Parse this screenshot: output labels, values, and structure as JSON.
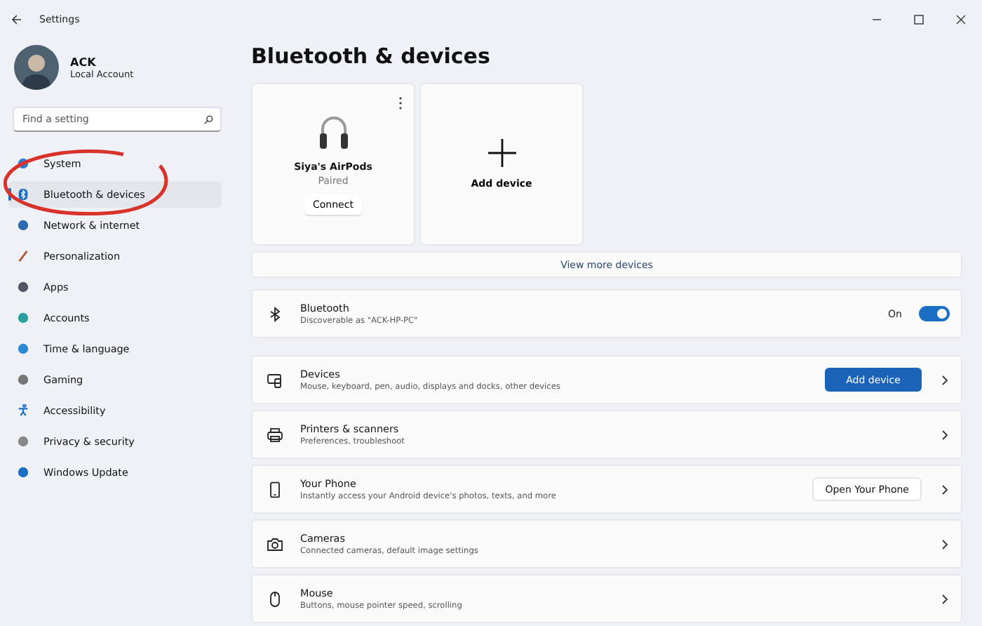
{
  "window": {
    "title": "Settings"
  },
  "account": {
    "name": "ACK",
    "type": "Local Account"
  },
  "search": {
    "placeholder": "Find a setting"
  },
  "sidebar": {
    "items": [
      {
        "label": "System",
        "selected": false
      },
      {
        "label": "Bluetooth & devices",
        "selected": true
      },
      {
        "label": "Network & internet",
        "selected": false
      },
      {
        "label": "Personalization",
        "selected": false
      },
      {
        "label": "Apps",
        "selected": false
      },
      {
        "label": "Accounts",
        "selected": false
      },
      {
        "label": "Time & language",
        "selected": false
      },
      {
        "label": "Gaming",
        "selected": false
      },
      {
        "label": "Accessibility",
        "selected": false
      },
      {
        "label": "Privacy & security",
        "selected": false
      },
      {
        "label": "Windows Update",
        "selected": false
      }
    ]
  },
  "page_title": "Bluetooth & devices",
  "device_card": {
    "name": "Siya's AirPods",
    "status": "Paired",
    "button": "Connect"
  },
  "add_card": {
    "label": "Add device"
  },
  "view_more": "View more devices",
  "rows": [
    {
      "kind": "toggle",
      "title": "Bluetooth",
      "subtitle": "Discoverable as \"ACK-HP-PC\"",
      "state_label": "On",
      "on": true
    },
    {
      "kind": "button",
      "title": "Devices",
      "subtitle": "Mouse, keyboard, pen, audio, displays and docks, other devices",
      "button": "Add device"
    },
    {
      "kind": "link",
      "title": "Printers & scanners",
      "subtitle": "Preferences, troubleshoot"
    },
    {
      "kind": "secondary",
      "title": "Your Phone",
      "subtitle": "Instantly access your Android device's photos, texts, and more",
      "button": "Open Your Phone"
    },
    {
      "kind": "link",
      "title": "Cameras",
      "subtitle": "Connected cameras, default image settings"
    },
    {
      "kind": "link",
      "title": "Mouse",
      "subtitle": "Buttons, mouse pointer speed, scrolling"
    }
  ]
}
